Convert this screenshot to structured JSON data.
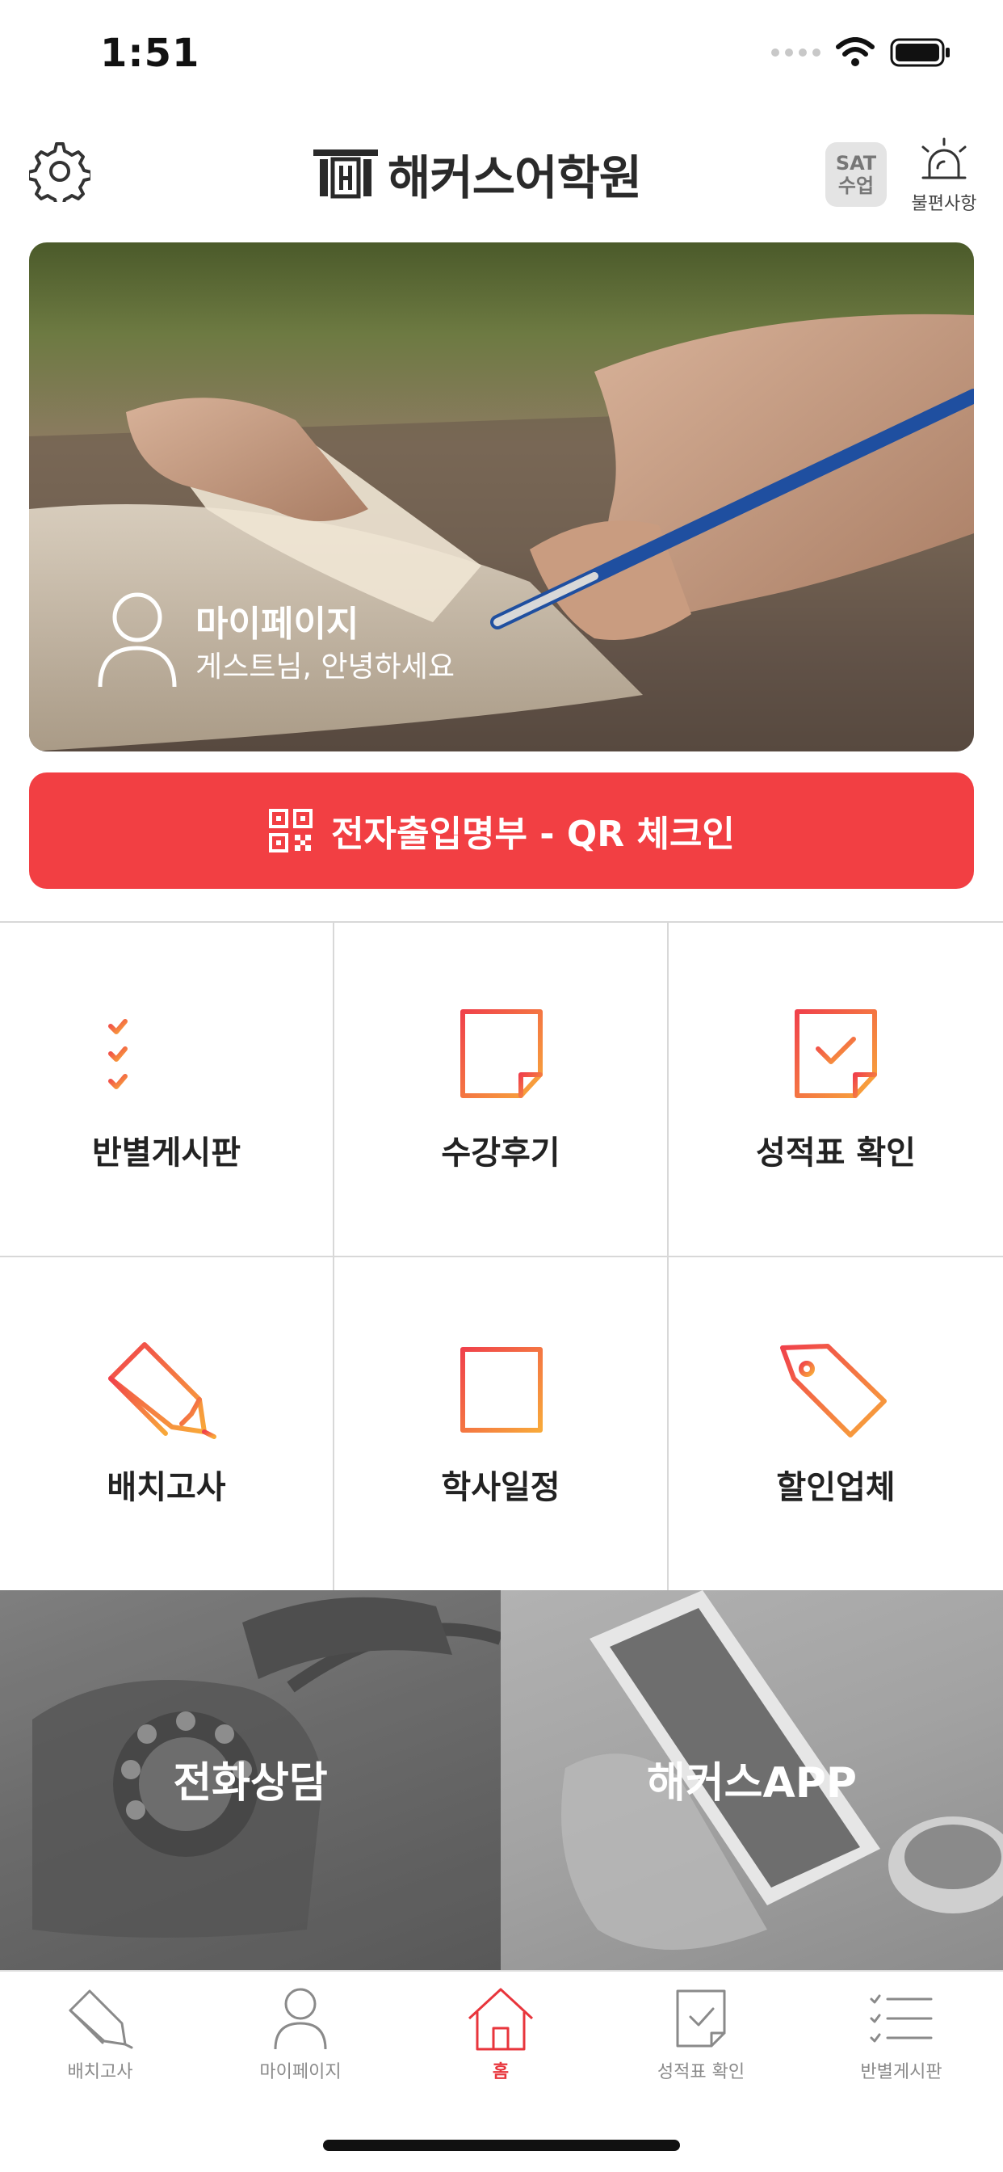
{
  "status_bar": {
    "time": "1:51"
  },
  "header": {
    "logo_title": "해커스어학원",
    "sat_line1": "SAT",
    "sat_line2": "수업",
    "complaint_label": "불편사항"
  },
  "hero": {
    "title": "마이페이지",
    "subtitle": "게스트님, 안녕하세요"
  },
  "qr_button": {
    "label": "전자출입명부 - QR 체크인"
  },
  "menu": [
    {
      "label": "반별게시판",
      "icon": "checklist-icon"
    },
    {
      "label": "수강후기",
      "icon": "document-icon"
    },
    {
      "label": "성적표 확인",
      "icon": "report-check-icon"
    },
    {
      "label": "배치고사",
      "icon": "pencil-icon"
    },
    {
      "label": "학사일정",
      "icon": "calendar-icon"
    },
    {
      "label": "할인업체",
      "icon": "tag-icon"
    }
  ],
  "tiles": [
    {
      "label": "전화상담"
    },
    {
      "label": "해커스APP"
    }
  ],
  "tabbar": [
    {
      "label": "배치고사",
      "icon": "pencil-icon"
    },
    {
      "label": "마이페이지",
      "icon": "person-icon"
    },
    {
      "label": "홈",
      "icon": "home-icon",
      "active": true
    },
    {
      "label": "성적표 확인",
      "icon": "report-check-icon"
    },
    {
      "label": "반별게시판",
      "icon": "checklist-icon"
    }
  ],
  "colors": {
    "accent": "#f23f43",
    "icon_gradient_start": "#f0414b",
    "icon_gradient_end": "#f8a93a",
    "tab_active": "#e8353c"
  }
}
